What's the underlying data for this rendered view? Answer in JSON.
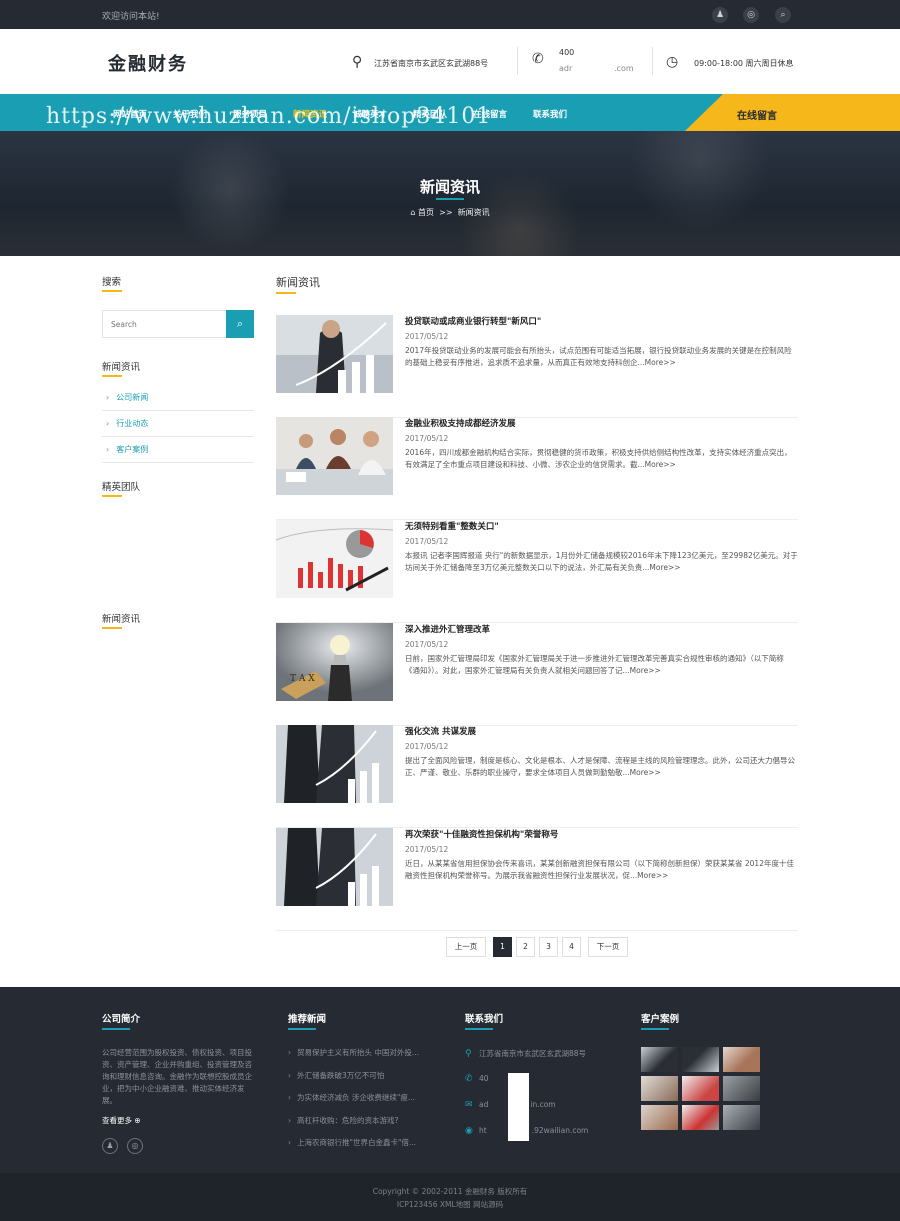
{
  "topbar": {
    "welcome": "欢迎访问本站!",
    "icons": [
      "qq-icon",
      "wechat-icon",
      "search-icon"
    ]
  },
  "header": {
    "logo": "金融财务",
    "address": "江苏省南京市玄武区玄武湖88号",
    "phone": "400",
    "email_prefix": "adr",
    "email_suffix": ".com",
    "hours": "09:00-18:00 周六周日休息"
  },
  "nav": {
    "items": [
      "网站首页",
      "关于我们",
      "服务项目",
      "新闻资讯",
      "诚聘英才",
      "精英团队",
      "在线留言",
      "联系我们"
    ],
    "active": "新闻资讯",
    "cta": "在线留言"
  },
  "watermark": "https://www.huzhan.com/ishop34101",
  "banner": {
    "title": "新闻资讯",
    "crumb_home": "首页",
    "crumb_sep": ">>",
    "crumb_current": "新闻资讯"
  },
  "sidebar": {
    "search_title": "搜索",
    "search_placeholder": "Search",
    "news_title": "新闻资讯",
    "categories": [
      "公司新闻",
      "行业动态",
      "客户案例"
    ],
    "team_title": "精英团队",
    "news_title2": "新闻资讯"
  },
  "main": {
    "title": "新闻资讯",
    "articles": [
      {
        "title": "投贷联动或成商业银行转型\"新风口\"",
        "date": "2017/05/12",
        "desc": "2017年投贷联动业务的发展可能会有所抬头，试点范围有可能适当拓展，银行投贷联动业务发展的关键是在控制风险的基础上稳妥有序推进，追求质不追求量，从而真正有效地支持科创企...More>>"
      },
      {
        "title": "金融业积极支持成都经济发展",
        "date": "2017/05/12",
        "desc": "2016年，四川成都金融机构结合实际，贯彻稳健的货币政策，积极支持供给侧结构性改革，支持实体经济重点突出，有效满足了全市重点项目建设和科技、小微、涉农企业的信贷需求。截...More>>"
      },
      {
        "title": "无须特别看重\"整数关口\"",
        "date": "2017/05/12",
        "desc": "本报讯 记者李国辉报道 央行\"的新数据显示，1月份外汇储备规模较2016年末下降123亿美元，至29982亿美元。对于坊间关于外汇储备降至3万亿美元整数关口以下的说法，外汇局有关负责...More>>"
      },
      {
        "title": "深入推进外汇管理改革",
        "date": "2017/05/12",
        "desc": "日前，国家外汇管理局印发《国家外汇管理局关于进一步推进外汇管理改革完善真实合规性审核的通知》（以下简称《通知》）。对此，国家外汇管理局有关负责人就相关问题回答了记...More>>"
      },
      {
        "title": "强化交流 共谋发展",
        "date": "2017/05/12",
        "desc": "提出了全面风险管理，制度是核心、文化是根本、人才是保障、流程是主线的风险管理理念。此外，公司还大力倡导公正、严谨、敬业、乐群的职业操守，要求全体项目人员做到勤勉敬...More>>"
      },
      {
        "title": "再次荣获\"十佳融资性担保机构\"荣誉称号",
        "date": "2017/05/12",
        "desc": "近日，从某某省信用担保协会传来喜讯，某某创新融资担保有限公司（以下简称创新担保）荣获某某省 2012年度十佳融资性担保机构荣誉称号。为展示我省融资性担保行业发展状况，促...More>>"
      }
    ]
  },
  "pagination": {
    "prev": "上一页",
    "pages": [
      "1",
      "2",
      "3",
      "4"
    ],
    "current": "1",
    "next": "下一页"
  },
  "footer": {
    "about_title": "公司简介",
    "about_text": "公司经营范围为股权投资、债权投资、项目投资、资产管理、企业并购重组、投资管理及咨询和理财信息咨询。金融作为联想控股成员企业，把为中小企业融资难、推动实体经济发展。",
    "more": "查看更多",
    "news_title": "推荐新闻",
    "news": [
      "贸易保护主义有所抬头 中国对外投...",
      "外汇储备跌破3万亿不可怕",
      "为实体经济减负 涉企收费继续\"瘦...",
      "高杠杆收购：危险的资本游戏?",
      "上海农商银行推\"世界白金鑫卡\"借..."
    ],
    "contact_title": "联系我们",
    "contact_address": "江苏省南京市玄武区玄武湖88号",
    "contact_phone_a": "40",
    "contact_phone_b": "8",
    "contact_email_a": "ad",
    "contact_email_b": "in.com",
    "contact_web_a": "ht",
    "contact_web_b": ".92wailian.com",
    "cases_title": "客户案例"
  },
  "copyright": {
    "line1": "Copyright © 2002-2011 金融财务 版权所有",
    "line2": "ICP123456 XML地图 网站源码"
  }
}
